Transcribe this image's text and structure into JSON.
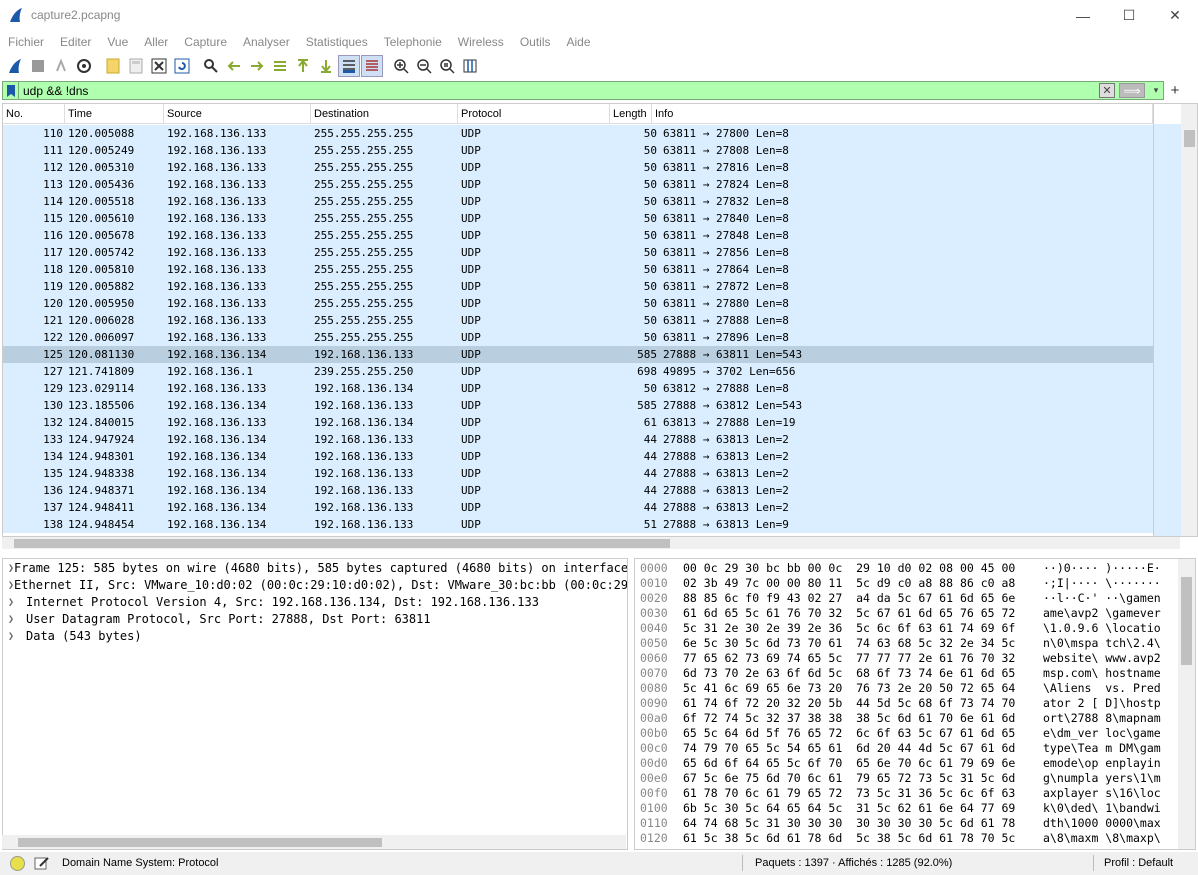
{
  "window": {
    "title": "capture2.pcapng",
    "minimize": "—",
    "maximize": "☐",
    "close": "✕"
  },
  "menu": [
    "Fichier",
    "Editer",
    "Vue",
    "Aller",
    "Capture",
    "Analyser",
    "Statistiques",
    "Telephonie",
    "Wireless",
    "Outils",
    "Aide"
  ],
  "filter": {
    "value": "udp && !dns",
    "clear": "✕",
    "apply": "⟹",
    "dropdown": "▾",
    "add": "+"
  },
  "columns": [
    "No.",
    "Time",
    "Source",
    "Destination",
    "Protocol",
    "Length",
    "Info"
  ],
  "packets": [
    {
      "no": "110",
      "time": "120.005088",
      "src": "192.168.136.133",
      "dst": "255.255.255.255",
      "proto": "UDP",
      "len": "50",
      "info": "63811 → 27800 Len=8"
    },
    {
      "no": "111",
      "time": "120.005249",
      "src": "192.168.136.133",
      "dst": "255.255.255.255",
      "proto": "UDP",
      "len": "50",
      "info": "63811 → 27808 Len=8"
    },
    {
      "no": "112",
      "time": "120.005310",
      "src": "192.168.136.133",
      "dst": "255.255.255.255",
      "proto": "UDP",
      "len": "50",
      "info": "63811 → 27816 Len=8"
    },
    {
      "no": "113",
      "time": "120.005436",
      "src": "192.168.136.133",
      "dst": "255.255.255.255",
      "proto": "UDP",
      "len": "50",
      "info": "63811 → 27824 Len=8"
    },
    {
      "no": "114",
      "time": "120.005518",
      "src": "192.168.136.133",
      "dst": "255.255.255.255",
      "proto": "UDP",
      "len": "50",
      "info": "63811 → 27832 Len=8"
    },
    {
      "no": "115",
      "time": "120.005610",
      "src": "192.168.136.133",
      "dst": "255.255.255.255",
      "proto": "UDP",
      "len": "50",
      "info": "63811 → 27840 Len=8"
    },
    {
      "no": "116",
      "time": "120.005678",
      "src": "192.168.136.133",
      "dst": "255.255.255.255",
      "proto": "UDP",
      "len": "50",
      "info": "63811 → 27848 Len=8"
    },
    {
      "no": "117",
      "time": "120.005742",
      "src": "192.168.136.133",
      "dst": "255.255.255.255",
      "proto": "UDP",
      "len": "50",
      "info": "63811 → 27856 Len=8"
    },
    {
      "no": "118",
      "time": "120.005810",
      "src": "192.168.136.133",
      "dst": "255.255.255.255",
      "proto": "UDP",
      "len": "50",
      "info": "63811 → 27864 Len=8"
    },
    {
      "no": "119",
      "time": "120.005882",
      "src": "192.168.136.133",
      "dst": "255.255.255.255",
      "proto": "UDP",
      "len": "50",
      "info": "63811 → 27872 Len=8"
    },
    {
      "no": "120",
      "time": "120.005950",
      "src": "192.168.136.133",
      "dst": "255.255.255.255",
      "proto": "UDP",
      "len": "50",
      "info": "63811 → 27880 Len=8"
    },
    {
      "no": "121",
      "time": "120.006028",
      "src": "192.168.136.133",
      "dst": "255.255.255.255",
      "proto": "UDP",
      "len": "50",
      "info": "63811 → 27888 Len=8"
    },
    {
      "no": "122",
      "time": "120.006097",
      "src": "192.168.136.133",
      "dst": "255.255.255.255",
      "proto": "UDP",
      "len": "50",
      "info": "63811 → 27896 Len=8"
    },
    {
      "no": "125",
      "time": "120.081130",
      "src": "192.168.136.134",
      "dst": "192.168.136.133",
      "proto": "UDP",
      "len": "585",
      "info": "27888 → 63811 Len=543",
      "selected": true
    },
    {
      "no": "127",
      "time": "121.741809",
      "src": "192.168.136.1",
      "dst": "239.255.255.250",
      "proto": "UDP",
      "len": "698",
      "info": "49895 → 3702 Len=656"
    },
    {
      "no": "129",
      "time": "123.029114",
      "src": "192.168.136.133",
      "dst": "192.168.136.134",
      "proto": "UDP",
      "len": "50",
      "info": "63812 → 27888 Len=8"
    },
    {
      "no": "130",
      "time": "123.185506",
      "src": "192.168.136.134",
      "dst": "192.168.136.133",
      "proto": "UDP",
      "len": "585",
      "info": "27888 → 63812 Len=543"
    },
    {
      "no": "132",
      "time": "124.840015",
      "src": "192.168.136.133",
      "dst": "192.168.136.134",
      "proto": "UDP",
      "len": "61",
      "info": "63813 → 27888 Len=19"
    },
    {
      "no": "133",
      "time": "124.947924",
      "src": "192.168.136.134",
      "dst": "192.168.136.133",
      "proto": "UDP",
      "len": "44",
      "info": "27888 → 63813 Len=2"
    },
    {
      "no": "134",
      "time": "124.948301",
      "src": "192.168.136.134",
      "dst": "192.168.136.133",
      "proto": "UDP",
      "len": "44",
      "info": "27888 → 63813 Len=2"
    },
    {
      "no": "135",
      "time": "124.948338",
      "src": "192.168.136.134",
      "dst": "192.168.136.133",
      "proto": "UDP",
      "len": "44",
      "info": "27888 → 63813 Len=2"
    },
    {
      "no": "136",
      "time": "124.948371",
      "src": "192.168.136.134",
      "dst": "192.168.136.133",
      "proto": "UDP",
      "len": "44",
      "info": "27888 → 63813 Len=2"
    },
    {
      "no": "137",
      "time": "124.948411",
      "src": "192.168.136.134",
      "dst": "192.168.136.133",
      "proto": "UDP",
      "len": "44",
      "info": "27888 → 63813 Len=2"
    },
    {
      "no": "138",
      "time": "124.948454",
      "src": "192.168.136.134",
      "dst": "192.168.136.133",
      "proto": "UDP",
      "len": "51",
      "info": "27888 → 63813 Len=9"
    }
  ],
  "details": [
    "Frame 125: 585 bytes on wire (4680 bits), 585 bytes captured (4680 bits) on interface",
    "Ethernet II, Src: VMware_10:d0:02 (00:0c:29:10:d0:02), Dst: VMware_30:bc:bb (00:0c:29:",
    "Internet Protocol Version 4, Src: 192.168.136.134, Dst: 192.168.136.133",
    "User Datagram Protocol, Src Port: 27888, Dst Port: 63811",
    "Data (543 bytes)"
  ],
  "bytes": [
    {
      "off": "0000",
      "hex": "00 0c 29 30 bc bb 00 0c  29 10 d0 02 08 00 45 00",
      "asc": "··)0···· )·····E·"
    },
    {
      "off": "0010",
      "hex": "02 3b 49 7c 00 00 80 11  5c d9 c0 a8 88 86 c0 a8",
      "asc": "·;I|···· \\·······"
    },
    {
      "off": "0020",
      "hex": "88 85 6c f0 f9 43 02 27  a4 da 5c 67 61 6d 65 6e",
      "asc": "··l··C·' ··\\gamen"
    },
    {
      "off": "0030",
      "hex": "61 6d 65 5c 61 76 70 32  5c 67 61 6d 65 76 65 72",
      "asc": "ame\\avp2 \\gamever"
    },
    {
      "off": "0040",
      "hex": "5c 31 2e 30 2e 39 2e 36  5c 6c 6f 63 61 74 69 6f",
      "asc": "\\1.0.9.6 \\locatio"
    },
    {
      "off": "0050",
      "hex": "6e 5c 30 5c 6d 73 70 61  74 63 68 5c 32 2e 34 5c",
      "asc": "n\\0\\mspa tch\\2.4\\"
    },
    {
      "off": "0060",
      "hex": "77 65 62 73 69 74 65 5c  77 77 77 2e 61 76 70 32",
      "asc": "website\\ www.avp2"
    },
    {
      "off": "0070",
      "hex": "6d 73 70 2e 63 6f 6d 5c  68 6f 73 74 6e 61 6d 65",
      "asc": "msp.com\\ hostname"
    },
    {
      "off": "0080",
      "hex": "5c 41 6c 69 65 6e 73 20  76 73 2e 20 50 72 65 64",
      "asc": "\\Aliens  vs. Pred"
    },
    {
      "off": "0090",
      "hex": "61 74 6f 72 20 32 20 5b  44 5d 5c 68 6f 73 74 70",
      "asc": "ator 2 [ D]\\hostp"
    },
    {
      "off": "00a0",
      "hex": "6f 72 74 5c 32 37 38 38  38 5c 6d 61 70 6e 61 6d",
      "asc": "ort\\2788 8\\mapnam"
    },
    {
      "off": "00b0",
      "hex": "65 5c 64 6d 5f 76 65 72  6c 6f 63 5c 67 61 6d 65",
      "asc": "e\\dm_ver loc\\game"
    },
    {
      "off": "00c0",
      "hex": "74 79 70 65 5c 54 65 61  6d 20 44 4d 5c 67 61 6d",
      "asc": "type\\Tea m DM\\gam"
    },
    {
      "off": "00d0",
      "hex": "65 6d 6f 64 65 5c 6f 70  65 6e 70 6c 61 79 69 6e",
      "asc": "emode\\op enplayin"
    },
    {
      "off": "00e0",
      "hex": "67 5c 6e 75 6d 70 6c 61  79 65 72 73 5c 31 5c 6d",
      "asc": "g\\numpla yers\\1\\m"
    },
    {
      "off": "00f0",
      "hex": "61 78 70 6c 61 79 65 72  73 5c 31 36 5c 6c 6f 63",
      "asc": "axplayer s\\16\\loc"
    },
    {
      "off": "0100",
      "hex": "6b 5c 30 5c 64 65 64 5c  31 5c 62 61 6e 64 77 69",
      "asc": "k\\0\\ded\\ 1\\bandwi"
    },
    {
      "off": "0110",
      "hex": "64 74 68 5c 31 30 30 30  30 30 30 30 5c 6d 61 78",
      "asc": "dth\\1000 0000\\max"
    },
    {
      "off": "0120",
      "hex": "61 5c 38 5c 6d 61 78 6d  5c 38 5c 6d 61 78 70 5c",
      "asc": "a\\8\\maxm \\8\\maxp\\"
    }
  ],
  "status": {
    "field": "Domain Name System: Protocol",
    "counts": "Paquets : 1397 · Affichés : 1285 (92.0%)",
    "profile": "Profil : Default"
  },
  "colors": {
    "row_bg": "#daeeff",
    "selected_row": "#b9cfe0",
    "filter_bg": "#afffaf"
  }
}
